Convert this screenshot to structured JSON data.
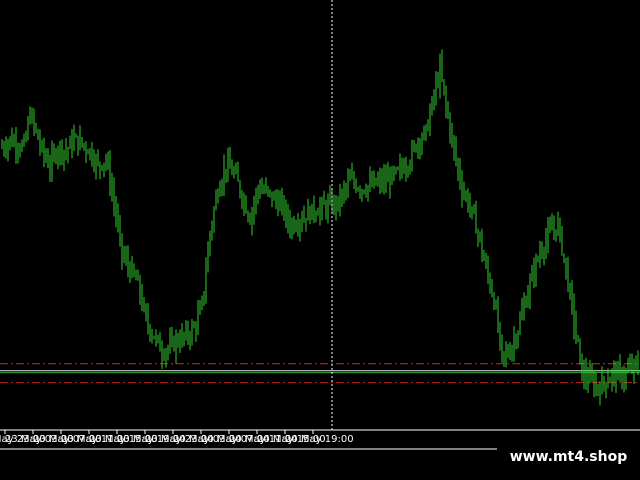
{
  "chart_data": {
    "type": "candlestick",
    "title": "",
    "xlabel": "",
    "ylabel": "",
    "grid": false,
    "y_range": [
      0,
      100
    ],
    "x_tick_labels": [
      "22 May 23:00",
      "23 May 03:00",
      "23 May 07:00",
      "23 May 11:00",
      "23 May 15:00",
      "23 May 19:00",
      "23 May 23:00",
      "24 May 03:00",
      "24 May 07:00",
      "24 May 11:00",
      "24 May 15:00",
      "24 May 19:00"
    ],
    "bars_per_tick": 14,
    "price_path": [
      [
        0,
        71
      ],
      [
        4,
        73
      ],
      [
        8,
        72
      ],
      [
        11,
        71
      ],
      [
        14,
        80
      ],
      [
        17,
        75
      ],
      [
        20,
        70
      ],
      [
        24,
        66
      ],
      [
        28,
        71
      ],
      [
        32,
        70
      ],
      [
        36,
        73
      ],
      [
        40,
        72
      ],
      [
        44,
        70
      ],
      [
        48,
        66
      ],
      [
        52,
        68
      ],
      [
        56,
        56
      ],
      [
        60,
        42
      ],
      [
        64,
        38
      ],
      [
        68,
        34
      ],
      [
        72,
        24
      ],
      [
        76,
        20
      ],
      [
        80,
        16
      ],
      [
        84,
        17
      ],
      [
        88,
        19
      ],
      [
        92,
        20
      ],
      [
        96,
        22
      ],
      [
        100,
        28
      ],
      [
        104,
        48
      ],
      [
        108,
        60
      ],
      [
        112,
        66
      ],
      [
        116,
        64
      ],
      [
        120,
        58
      ],
      [
        124,
        52
      ],
      [
        128,
        60
      ],
      [
        132,
        59
      ],
      [
        136,
        57
      ],
      [
        140,
        55
      ],
      [
        144,
        50
      ],
      [
        150,
        52
      ],
      [
        156,
        54
      ],
      [
        162,
        55
      ],
      [
        168,
        56
      ],
      [
        174,
        62
      ],
      [
        180,
        60
      ],
      [
        186,
        61
      ],
      [
        192,
        62
      ],
      [
        198,
        64
      ],
      [
        204,
        68
      ],
      [
        208,
        73
      ],
      [
        212,
        75
      ],
      [
        216,
        85
      ],
      [
        219,
        92
      ],
      [
        222,
        82
      ],
      [
        226,
        70
      ],
      [
        230,
        60
      ],
      [
        234,
        55
      ],
      [
        238,
        48
      ],
      [
        242,
        38
      ],
      [
        246,
        30
      ],
      [
        250,
        14
      ],
      [
        254,
        16
      ],
      [
        258,
        22
      ],
      [
        262,
        30
      ],
      [
        266,
        38
      ],
      [
        270,
        44
      ],
      [
        274,
        48
      ],
      [
        278,
        50
      ],
      [
        282,
        38
      ],
      [
        286,
        24
      ],
      [
        290,
        10
      ],
      [
        294,
        8
      ],
      [
        298,
        6
      ],
      [
        302,
        8
      ],
      [
        306,
        10
      ],
      [
        310,
        9
      ],
      [
        314,
        11
      ],
      [
        318,
        12
      ]
    ],
    "reference_levels": [
      {
        "value": 12.5,
        "color": "#e02020",
        "style": "dash-dot"
      },
      {
        "value": 10.6,
        "color": "#e8e8e8",
        "style": "solid"
      },
      {
        "value": 10.1,
        "color": "#2ea82e",
        "style": "solid"
      },
      {
        "value": 7.4,
        "color": "#c02020",
        "style": "dash-dot"
      }
    ],
    "crosshair_x_bar": 165,
    "colors": {
      "background": "#000000",
      "candle": "#32cd32",
      "candle_body": "#90ee90",
      "axis": "#ffffff",
      "crosshair": "#ffffff"
    }
  },
  "watermark": "www.mt4.shop"
}
